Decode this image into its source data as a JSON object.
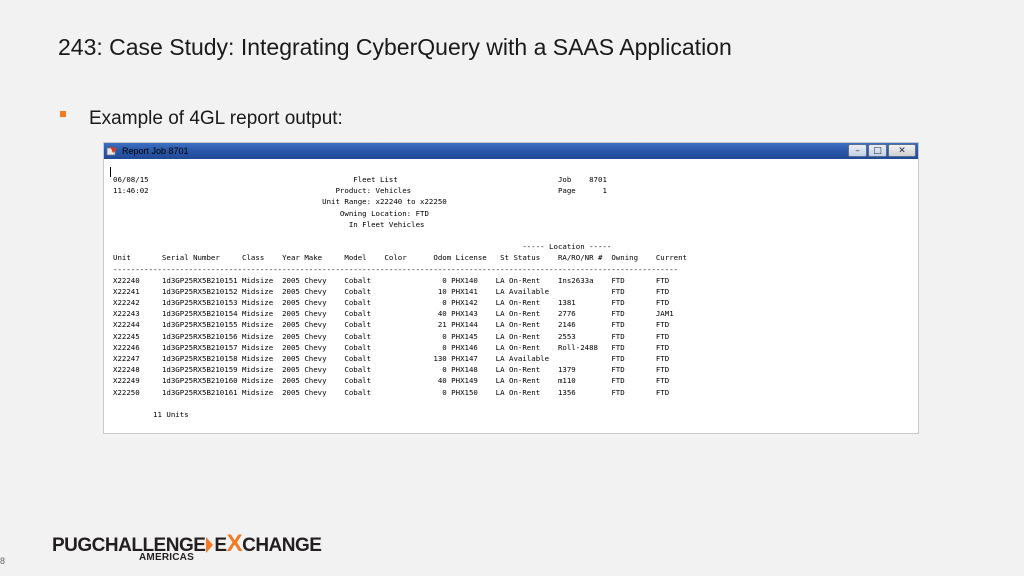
{
  "slide": {
    "title": "243: Case Study: Integrating CyberQuery with a SAAS Application",
    "bullet": "Example of 4GL report output:",
    "slide_number": "8"
  },
  "window": {
    "title": "Report Job 8701",
    "controls": {
      "minimize": "–",
      "maximize": "□",
      "close": "✕"
    }
  },
  "report": {
    "lines": [
      "06/08/15                                              Fleet List                                    Job    8701",
      "11:46:02                                          Product: Vehicles                                 Page      1",
      "                                               Unit Range: x22240 to x22250",
      "                                                   Owning Location: FTD",
      "                                                     In Fleet Vehicles",
      "",
      "                                                                                            ----- Location -----",
      "Unit       Serial Number     Class    Year Make     Model    Color      Odom License   St Status    RA/RO/NR #  Owning    Current",
      "-------------------------------------------------------------------------------------------------------------------------------",
      "X22240     1d3GP25RX5B210151 Midsize  2005 Chevy    Cobalt                0 PHX140    LA On-Rent    Ins2633a    FTD       FTD",
      "X22241     1d3GP25RX5B210152 Midsize  2005 Chevy    Cobalt               10 PHX141    LA Available              FTD       FTD",
      "X22242     1d3GP25RX5B210153 Midsize  2005 Chevy    Cobalt                0 PHX142    LA On-Rent    1381        FTD       FTD",
      "X22243     1d3GP25RX5B210154 Midsize  2005 Chevy    Cobalt               40 PHX143    LA On-Rent    2776        FTD       JAM1",
      "X22244     1d3GP25RX5B210155 Midsize  2005 Chevy    Cobalt               21 PHX144    LA On-Rent    2146        FTD       FTD",
      "X22245     1d3GP25RX5B210156 Midsize  2005 Chevy    Cobalt                0 PHX145    LA On-Rent    2553        FTD       FTD",
      "X22246     1d3GP25RX5B210157 Midsize  2005 Chevy    Cobalt                0 PHX146    LA On-Rent    Roll-2488   FTD       FTD",
      "X22247     1d3GP25RX5B210158 Midsize  2005 Chevy    Cobalt              130 PHX147    LA Available              FTD       FTD",
      "X22248     1d3GP25RX5B210159 Midsize  2005 Chevy    Cobalt                0 PHX148    LA On-Rent    1379        FTD       FTD",
      "X22249     1d3GP25RX5B210160 Midsize  2005 Chevy    Cobalt               40 PHX149    LA On-Rent    m110        FTD       FTD",
      "X22250     1d3GP25RX5B210161 Midsize  2005 Chevy    Cobalt                0 PHX150    LA On-Rent    1356        FTD       FTD",
      "",
      "         11 Units"
    ]
  },
  "logo": {
    "part1": "PUGCHALLENGE",
    "part2": "E",
    "part3": "X",
    "part4": "CHANGE",
    "sub": "AMERICAS",
    "accent_color": "#f47920",
    "dark_color": "#231f20"
  }
}
